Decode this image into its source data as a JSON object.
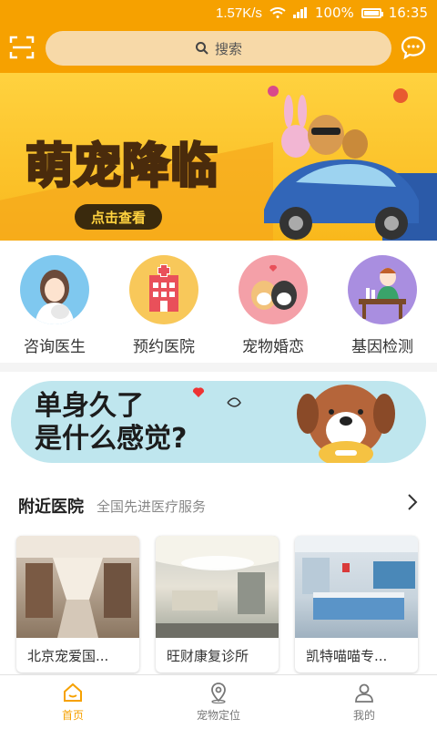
{
  "status_bar": {
    "net_speed": "1.57K/s",
    "battery": "100%",
    "time": "16:35"
  },
  "header": {
    "search_placeholder": "搜索"
  },
  "banner": {
    "title": "萌宠降临",
    "cta": "点击查看"
  },
  "categories": [
    {
      "label": "咨询医生",
      "icon": "doctor-icon"
    },
    {
      "label": "预约医院",
      "icon": "hospital-icon"
    },
    {
      "label": "宠物婚恋",
      "icon": "pet-love-icon"
    },
    {
      "label": "基因检测",
      "icon": "gene-test-icon"
    }
  ],
  "promo": {
    "line1": "单身久了",
    "line2": "是什么感觉?"
  },
  "nearby": {
    "title": "附近医院",
    "subtitle": "全国先进医疗服务",
    "hospitals": [
      {
        "name": "北京宠爱国..."
      },
      {
        "name": "旺财康复诊所"
      },
      {
        "name": "凯特喵喵专..."
      }
    ]
  },
  "tabbar": {
    "items": [
      {
        "label": "首页",
        "icon": "home-icon",
        "active": true
      },
      {
        "label": "宠物定位",
        "icon": "location-icon",
        "active": false
      },
      {
        "label": "我的",
        "icon": "profile-icon",
        "active": false
      }
    ]
  },
  "colors": {
    "accent": "#f6a100",
    "search_bg": "#f7d9a8",
    "banner_yellow": "#ffd23f",
    "promo_bg": "#bfe6ee"
  }
}
